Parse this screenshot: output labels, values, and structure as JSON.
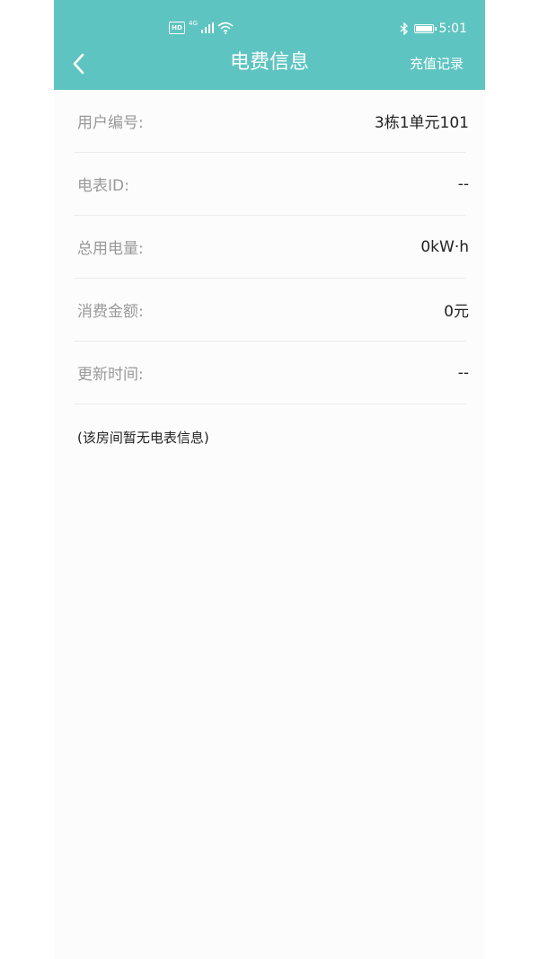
{
  "colors": {
    "header_bg": "#5ec4c1",
    "label": "#999999",
    "value": "#222222"
  },
  "status_bar": {
    "hd_label": "HD",
    "network_label": "4G",
    "time": "5:01"
  },
  "header": {
    "title": "电费信息",
    "recharge_label": "充值记录",
    "back_icon": "chevron-left-icon"
  },
  "info": {
    "rows": [
      {
        "label": "用户编号:",
        "value": "3栋1单元101"
      },
      {
        "label": "电表ID:",
        "value": "--"
      },
      {
        "label": "总用电量:",
        "value": "0kW·h"
      },
      {
        "label": "消费金额:",
        "value": "0元"
      },
      {
        "label": "更新时间:",
        "value": "--"
      }
    ],
    "note": "(该房间暂无电表信息)"
  }
}
